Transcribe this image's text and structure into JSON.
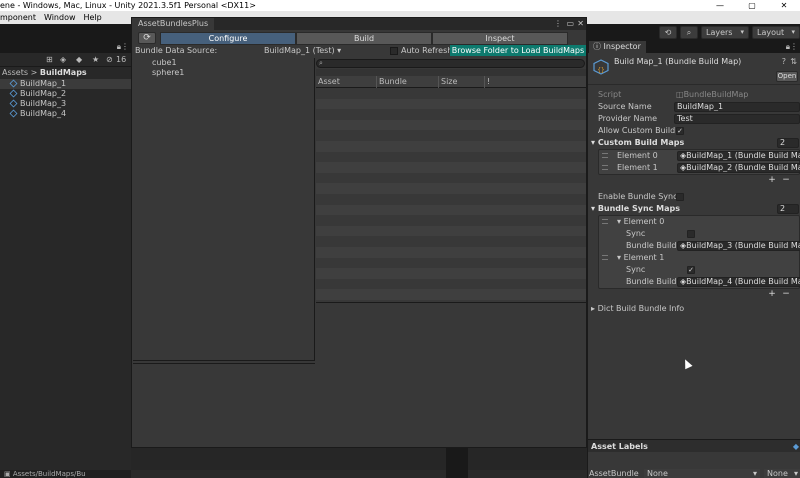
{
  "window": {
    "title": "ene - Windows, Mac, Linux - Unity 2021.3.5f1 Personal <DX11>",
    "controls": [
      "—",
      "▢",
      "✕"
    ]
  },
  "menu": [
    "mponent",
    "Window",
    "Help"
  ],
  "toolbar": {
    "history_icon": "history-icon",
    "search_icon": "search-icon",
    "layers": "Layers",
    "layout": "Layout"
  },
  "project": {
    "breadcrumb_root": "Assets",
    "breadcrumb_sep": ">",
    "breadcrumb_current": "BuildMaps",
    "count": "16",
    "files": [
      "BuildMap_1",
      "BuildMap_2",
      "BuildMap_3",
      "BuildMap_4"
    ],
    "status": "Assets/BuildMaps/Bu"
  },
  "abp": {
    "tab_title": "AssetBundlesPlus",
    "tabs": [
      "Configure",
      "Build",
      "Inspect"
    ],
    "data_source_label": "Bundle Data Source:",
    "data_source_value": "BuildMap_1 (Test)",
    "auto_refresh_label": "Auto Refresh",
    "browse_button": "Browse Folder to Load BuildMaps",
    "tree_items": [
      "cube1",
      "sphere1"
    ],
    "search_placeholder": "",
    "columns": [
      "Asset",
      "Bundle",
      "Size",
      "!"
    ]
  },
  "inspector": {
    "tab": "Inspector",
    "asset_name": "Build Map_1 (Bundle Build Map)",
    "open_button": "Open",
    "script_label": "Script",
    "script_value": "BundleBuildMap",
    "source_name_label": "Source Name",
    "source_name_value": "BuildMap_1",
    "provider_name_label": "Provider Name",
    "provider_name_value": "Test",
    "allow_custom_build_label": "Allow Custom Build",
    "allow_custom_build": "✓",
    "custom_build_maps_label": "Custom Build Maps",
    "custom_build_maps_count": "2",
    "element0_label": "Element 0",
    "element0_value": "BuildMap_1 (Bundle Build Ma",
    "element1_label": "Element 1",
    "element1_value": "BuildMap_2 (Bundle Build Ma",
    "enable_bundle_sync_label": "Enable Bundle Sync",
    "bundle_sync_maps_label": "Bundle Sync Maps",
    "bundle_sync_maps_count": "2",
    "sync_element0_label": "Element 0",
    "sync_label": "Sync",
    "bundle_build_label": "Bundle Build M",
    "sync_element0_value": "BuildMap_3 (Bundle Build Ma",
    "sync_element1_label": "Element 1",
    "sync_element1_check": "✓",
    "sync_element1_value": "BuildMap_4 (Bundle Build Ma",
    "dict_build_bundle_info": "Dict Build Bundle Info",
    "asset_labels": "Asset Labels",
    "asset_bundle_label": "AssetBundle",
    "asset_bundle_value": "None",
    "asset_bundle_variant": "None",
    "plus": "+",
    "minus": "−"
  },
  "colors": {
    "active_tab": "#46607c",
    "browse_button": "#0d7a6e",
    "icon_blue": "#5b9bd5"
  }
}
